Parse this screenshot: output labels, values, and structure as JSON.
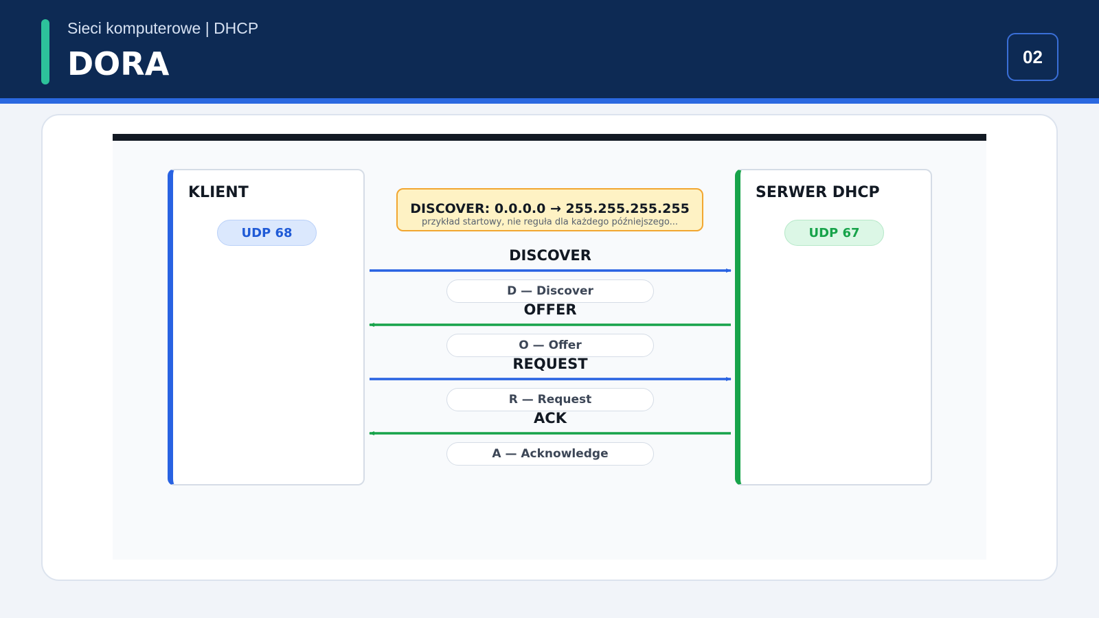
{
  "header": {
    "subtitle": "Sieci komputerowe | DHCP",
    "title": "DORA",
    "page_number": "02"
  },
  "diagram": {
    "topbar_caption": "",
    "client": {
      "title": "KLIENT",
      "port": "UDP 68",
      "color": "#2862e2"
    },
    "server": {
      "title": "SERWER DHCP",
      "port": "UDP 67",
      "color": "#17a34a"
    },
    "note": {
      "main": "DISCOVER: 0.0.0.0 → 255.255.255.255",
      "sub": "przykład startowy, nie reguła dla każdego późniejszego..."
    },
    "messages": [
      {
        "label": "DISCOVER",
        "caption": "D — Discover",
        "direction": "client-to-server",
        "color": "#2862e2"
      },
      {
        "label": "OFFER",
        "caption": "O — Offer",
        "direction": "server-to-client",
        "color": "#17a34a"
      },
      {
        "label": "REQUEST",
        "caption": "R — Request",
        "direction": "client-to-server",
        "color": "#2862e2"
      },
      {
        "label": "ACK",
        "caption": "A — Acknowledge",
        "direction": "server-to-client",
        "color": "#17a34a"
      }
    ]
  }
}
